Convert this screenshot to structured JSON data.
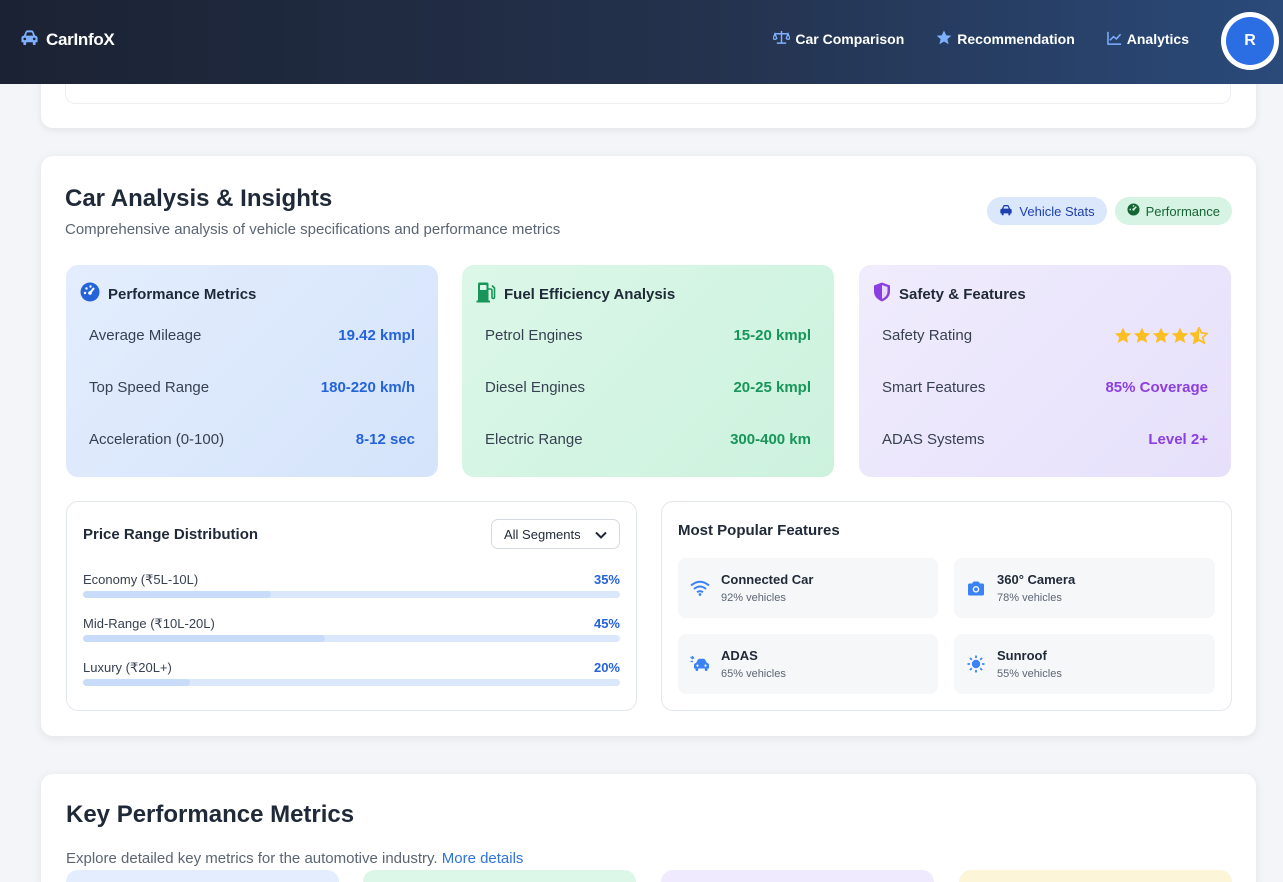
{
  "header": {
    "brand": "CarInfoX",
    "nav": [
      {
        "label": "Car Comparison",
        "icon": "scale-icon"
      },
      {
        "label": "Recommendation",
        "icon": "star-icon"
      },
      {
        "label": "Analytics",
        "icon": "chart-line-icon"
      }
    ],
    "avatar_initial": "R"
  },
  "insights": {
    "title": "Car Analysis & Insights",
    "subtitle": "Comprehensive analysis of vehicle specifications and performance metrics",
    "tags": [
      {
        "label": "Vehicle Stats",
        "icon": "car-icon"
      },
      {
        "label": "Performance",
        "icon": "gauge-icon"
      }
    ],
    "cards": [
      {
        "title": "Performance Metrics",
        "rows": [
          {
            "label": "Average Mileage",
            "value": "19.42 kmpl"
          },
          {
            "label": "Top Speed Range",
            "value": "180-220 km/h"
          },
          {
            "label": "Acceleration (0-100)",
            "value": "8-12 sec"
          }
        ]
      },
      {
        "title": "Fuel Efficiency Analysis",
        "rows": [
          {
            "label": "Petrol Engines",
            "value": "15-20 kmpl"
          },
          {
            "label": "Diesel Engines",
            "value": "20-25 kmpl"
          },
          {
            "label": "Electric Range",
            "value": "300-400 km"
          }
        ]
      },
      {
        "title": "Safety & Features",
        "rows": [
          {
            "label": "Safety Rating",
            "rating": 4.5
          },
          {
            "label": "Smart Features",
            "value": "85% Coverage"
          },
          {
            "label": "ADAS Systems",
            "value": "Level 2+"
          }
        ]
      }
    ],
    "price": {
      "title": "Price Range Distribution",
      "select_value": "All Segments",
      "rows": [
        {
          "label": "Economy (₹5L-10L)",
          "pct_label": "35%",
          "pct": 35
        },
        {
          "label": "Mid-Range (₹10L-20L)",
          "pct_label": "45%",
          "pct": 45
        },
        {
          "label": "Luxury (₹20L+)",
          "pct_label": "20%",
          "pct": 20
        }
      ]
    },
    "features": {
      "title": "Most Popular Features",
      "items": [
        {
          "name": "Connected Car",
          "sub": "92% vehicles",
          "icon": "wifi-icon"
        },
        {
          "name": "360° Camera",
          "sub": "78% vehicles",
          "icon": "camera-icon"
        },
        {
          "name": "ADAS",
          "sub": "65% vehicles",
          "icon": "car-burst-icon"
        },
        {
          "name": "Sunroof",
          "sub": "55% vehicles",
          "icon": "sun-icon"
        }
      ]
    }
  },
  "kpm": {
    "title": "Key Performance Metrics",
    "subtitle": "Explore detailed key metrics for the automotive industry.",
    "link": "More details"
  },
  "colors": {
    "accent": "#2563d9",
    "green": "#17955a",
    "purple": "#8b3fe0",
    "star": "#fbbf24"
  }
}
